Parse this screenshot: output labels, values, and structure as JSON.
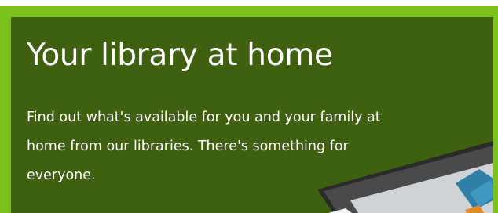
{
  "promo": {
    "title": "Your library at home",
    "description_lines": [
      "Find out what's available for you and your family at",
      "home from our libraries. There's something for",
      "everyone."
    ]
  },
  "colors": {
    "frame": "#7cc21f",
    "panel": "#3f600f",
    "text": "#ffffff"
  },
  "icons": {
    "tablet": "tablet-illustration"
  }
}
